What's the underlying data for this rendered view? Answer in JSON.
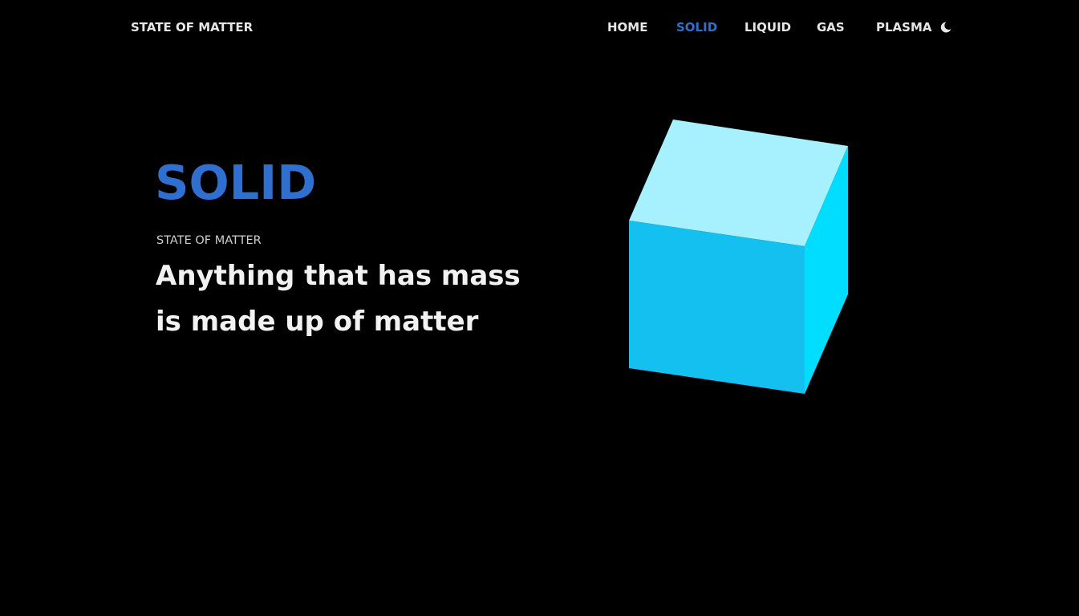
{
  "header": {
    "brand": "STATE OF MATTER",
    "nav": [
      {
        "label": "HOME",
        "active": false
      },
      {
        "label": "SOLID",
        "active": true
      },
      {
        "label": "LIQUID",
        "active": false
      },
      {
        "label": "GAS",
        "active": false
      },
      {
        "label": "PLASMA",
        "active": false
      }
    ],
    "theme_icon": "moon-icon"
  },
  "hero": {
    "title": "SOLID",
    "subtitle": "STATE OF MATTER",
    "description": "Anything that has mass is made up of matter",
    "illustration": "cube-icon"
  },
  "colors": {
    "background": "#000000",
    "accent": "#2e6fd0",
    "text": "#f2f2f2",
    "cube_top": "#a6f1fd",
    "cube_front": "#14c0f0",
    "cube_side": "#00ddff"
  }
}
